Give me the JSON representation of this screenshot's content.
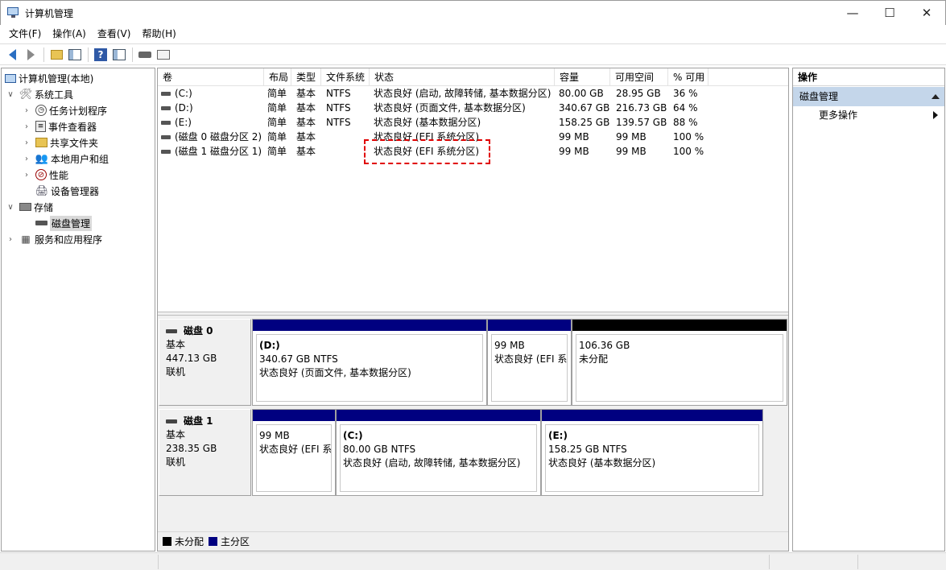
{
  "window": {
    "title": "计算机管理",
    "controls": [
      "—",
      "☐",
      "✕"
    ]
  },
  "menu": [
    "文件(F)",
    "操作(A)",
    "查看(V)",
    "帮助(H)"
  ],
  "tree": [
    {
      "label": "计算机管理(本地)",
      "icon": "computer-icon",
      "level": 0,
      "chevron": ""
    },
    {
      "label": "系统工具",
      "icon": "tools-icon",
      "level": 1,
      "chevron": "∨"
    },
    {
      "label": "任务计划程序",
      "icon": "clock-icon",
      "level": 2,
      "chevron": "›"
    },
    {
      "label": "事件查看器",
      "icon": "event-viewer-icon",
      "level": 2,
      "chevron": "›"
    },
    {
      "label": "共享文件夹",
      "icon": "shared-folder-icon",
      "level": 2,
      "chevron": "›"
    },
    {
      "label": "本地用户和组",
      "icon": "users-icon",
      "level": 2,
      "chevron": "›"
    },
    {
      "label": "性能",
      "icon": "performance-icon",
      "level": 2,
      "chevron": "›"
    },
    {
      "label": "设备管理器",
      "icon": "device-manager-icon",
      "level": 2,
      "chevron": ""
    },
    {
      "label": "存储",
      "icon": "storage-icon",
      "level": 1,
      "chevron": "∨"
    },
    {
      "label": "磁盘管理",
      "icon": "disk-icon",
      "level": 2,
      "chevron": "",
      "selected": true
    },
    {
      "label": "服务和应用程序",
      "icon": "services-icon",
      "level": 1,
      "chevron": "›"
    }
  ],
  "columns": [
    "卷",
    "布局",
    "类型",
    "文件系统",
    "状态",
    "容量",
    "可用空间",
    "% 可用"
  ],
  "volumes": [
    [
      "(C:)",
      "简单",
      "基本",
      "NTFS",
      "状态良好 (启动, 故障转储, 基本数据分区)",
      "80.00 GB",
      "28.95 GB",
      "36 %"
    ],
    [
      "(D:)",
      "简单",
      "基本",
      "NTFS",
      "状态良好 (页面文件, 基本数据分区)",
      "340.67 GB",
      "216.73 GB",
      "64 %"
    ],
    [
      "(E:)",
      "简单",
      "基本",
      "NTFS",
      "状态良好 (基本数据分区)",
      "158.25 GB",
      "139.57 GB",
      "88 %"
    ],
    [
      "(磁盘 0 磁盘分区 2)",
      "简单",
      "基本",
      "",
      "状态良好 (EFI 系统分区)",
      "99 MB",
      "99 MB",
      "100 %"
    ],
    [
      "(磁盘 1 磁盘分区 1)",
      "简单",
      "基本",
      "",
      "状态良好 (EFI 系统分区)",
      "99 MB",
      "99 MB",
      "100 %"
    ]
  ],
  "disks": [
    {
      "name": "磁盘 0",
      "type": "基本",
      "size": "447.13 GB",
      "status": "联机",
      "partitions": [
        {
          "name": "(D:)",
          "size": "340.67 GB NTFS",
          "status": "状态良好 (页面文件, 基本数据分区)",
          "color": "#000080"
        },
        {
          "name": "",
          "size": "99 MB",
          "status": "状态良好 (EFI 系",
          "color": "#000080"
        },
        {
          "name": "",
          "size": "106.36 GB",
          "status": "未分配",
          "color": "#000000"
        }
      ]
    },
    {
      "name": "磁盘 1",
      "type": "基本",
      "size": "238.35 GB",
      "status": "联机",
      "partitions": [
        {
          "name": "",
          "size": "99 MB",
          "status": "状态良好 (EFI 系",
          "color": "#000080"
        },
        {
          "name": "(C:)",
          "size": "80.00 GB NTFS",
          "status": "状态良好 (启动, 故障转储, 基本数据分区)",
          "color": "#000080"
        },
        {
          "name": "(E:)",
          "size": "158.25 GB NTFS",
          "status": "状态良好 (基本数据分区)",
          "color": "#000080"
        }
      ]
    }
  ],
  "legend": [
    {
      "label": "未分配",
      "color": "#000000"
    },
    {
      "label": "主分区",
      "color": "#000080"
    }
  ],
  "actions": {
    "title": "操作",
    "section": "磁盘管理",
    "items": [
      "更多操作"
    ]
  }
}
